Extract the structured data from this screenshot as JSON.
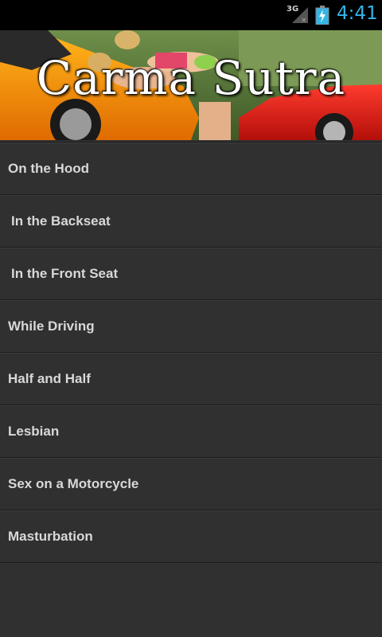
{
  "status_bar": {
    "network_type": "3G",
    "time": "4:41",
    "signal_icon": "signal-no-data-icon",
    "battery_icon": "battery-charging-icon",
    "accent_color": "#33b5e5"
  },
  "banner": {
    "title": "Carma Sutra"
  },
  "menu": {
    "items": [
      {
        "label": "On the Hood"
      },
      {
        "label": "In the Backseat"
      },
      {
        "label": "In the Front Seat"
      },
      {
        "label": "While Driving"
      },
      {
        "label": "Half and Half"
      },
      {
        "label": "Lesbian"
      },
      {
        "label": "Sex on a Motorcycle"
      },
      {
        "label": "Masturbation"
      }
    ]
  }
}
